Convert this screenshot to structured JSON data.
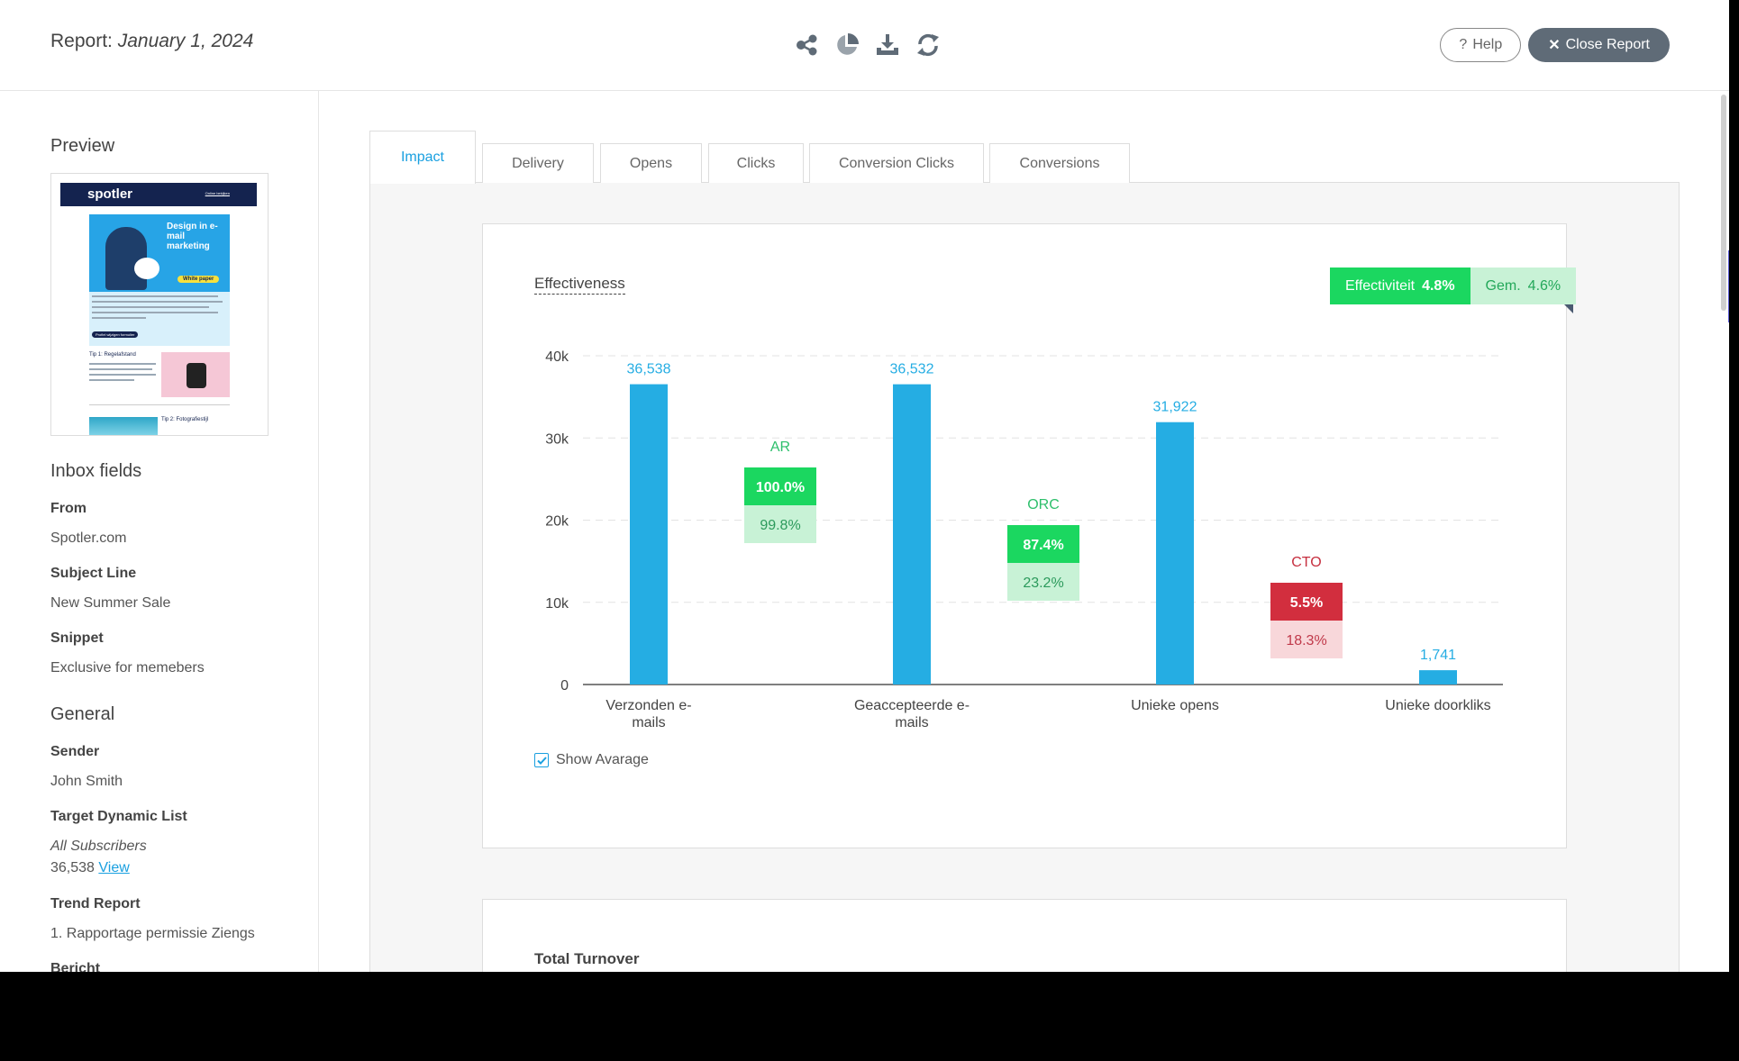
{
  "header": {
    "report_label": "Report:",
    "report_date": "January 1, 2024",
    "help_label": "Help",
    "close_label": "Close Report"
  },
  "sidebar": {
    "preview_title": "Preview",
    "preview_thumb": {
      "brand": "spotler",
      "nav_link": "Online bekijken",
      "hero_text": "Design in e-mail marketing",
      "hero_tag": "White paper",
      "cta": "Profiel wijzigen formulier",
      "tip1": "Tip 1: Regelafstand",
      "tip2": "Tip 2: Fotografiestijl"
    },
    "inbox_title": "Inbox fields",
    "from_label": "From",
    "from_value": "Spotler.com",
    "subject_label": "Subject Line",
    "subject_value": "New Summer Sale",
    "snippet_label": "Snippet",
    "snippet_value": "Exclusive for memebers",
    "general_title": "General",
    "sender_label": "Sender",
    "sender_value": "John Smith",
    "target_label": "Target Dynamic List",
    "target_list": "All Subscribers",
    "target_count": "36,538",
    "target_view": "View",
    "trend_label": "Trend Report",
    "trend_value": "1. Rapportage permissie Ziengs",
    "bericht_label": "Bericht"
  },
  "tabs": [
    {
      "label": "Impact",
      "active": true
    },
    {
      "label": "Delivery",
      "active": false
    },
    {
      "label": "Opens",
      "active": false
    },
    {
      "label": "Clicks",
      "active": false
    },
    {
      "label": "Conversion Clicks",
      "active": false
    },
    {
      "label": "Conversions",
      "active": false
    }
  ],
  "effectiveness": {
    "title": "Effectiveness",
    "badge_label": "Effectiviteit",
    "badge_value": "4.8%",
    "avg_label": "Gem.",
    "avg_value": "4.6%",
    "show_average_label": "Show Avarage",
    "show_average_checked": true
  },
  "turnover": {
    "title": "Total Turnover"
  },
  "colors": {
    "bar": "#25ade3",
    "green": "#1bd760",
    "green_light": "#c8f2d6",
    "green_text": "#2dbf6b",
    "red": "#d22e3e",
    "red_light": "#f8d7da",
    "red_text": "#c62f3f"
  },
  "chart_data": {
    "type": "bar",
    "title": "Effectiveness",
    "categories": [
      "Verzonden e-mails",
      "Geaccepteerde e-mails",
      "Unieke opens",
      "Unieke doorkliks"
    ],
    "category_lines": [
      [
        "Verzonden e-",
        "mails"
      ],
      [
        "Geaccepteerde e-",
        "mails"
      ],
      [
        "Unieke opens"
      ],
      [
        "Unieke doorkliks"
      ]
    ],
    "values": [
      36538,
      36532,
      31922,
      1741
    ],
    "value_labels": [
      "36,538",
      "36,532",
      "31,922",
      "1,741"
    ],
    "ylim": [
      0,
      40000
    ],
    "yticks": [
      0,
      10000,
      20000,
      30000,
      40000
    ],
    "ytick_labels": [
      "0",
      "10k",
      "20k",
      "30k",
      "40k"
    ],
    "grid": true,
    "ratios": [
      {
        "name": "AR",
        "value": 100.0,
        "label": "100.0%",
        "average": 99.8,
        "avg_label": "99.8%",
        "status": "good"
      },
      {
        "name": "ORC",
        "value": 87.4,
        "label": "87.4%",
        "average": 23.2,
        "avg_label": "23.2%",
        "status": "good"
      },
      {
        "name": "CTO",
        "value": 5.5,
        "label": "5.5%",
        "average": 18.3,
        "avg_label": "18.3%",
        "status": "bad"
      }
    ]
  }
}
